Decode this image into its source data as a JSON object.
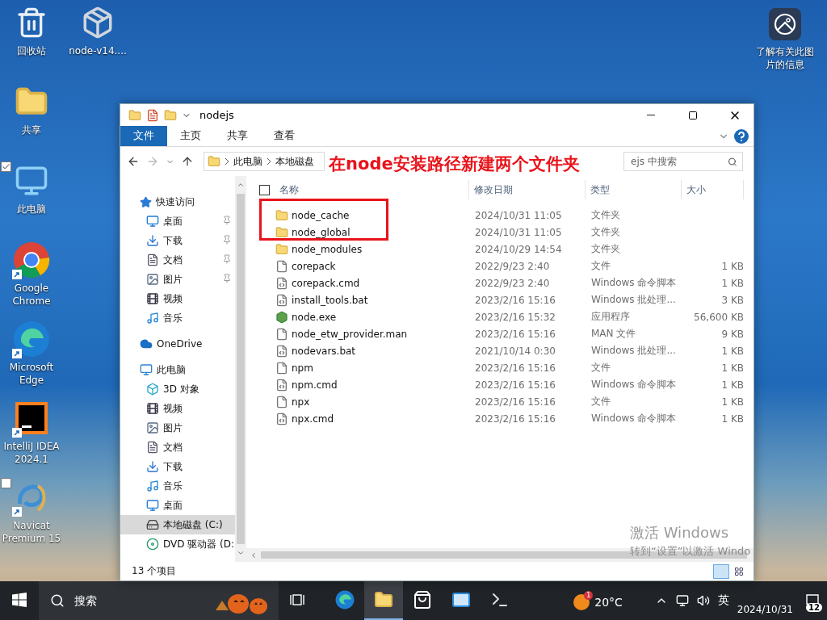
{
  "desktop": {
    "icons": [
      {
        "label": "回收站",
        "kind": "recycle"
      },
      {
        "label": "共享",
        "kind": "folder"
      },
      {
        "label": "此电脑",
        "kind": "computer",
        "checked": true
      },
      {
        "label": "Google Chrome",
        "kind": "chrome",
        "shortcut": true
      },
      {
        "label": "Microsoft Edge",
        "kind": "edge",
        "shortcut": true
      },
      {
        "label": "IntelliJ IDEA 2024.1",
        "kind": "idea",
        "shortcut": true
      },
      {
        "label": "Navicat Premium 15",
        "kind": "navicat",
        "shortcut": true,
        "checked": false
      },
      {
        "label": "node-v14....",
        "kind": "installer"
      }
    ],
    "info_icon": {
      "label": "了解有关此图片的信息"
    },
    "activation": {
      "title": "激活 Windows",
      "subtitle": "转到“设置”以激活 Windo"
    }
  },
  "window": {
    "title": "nodejs",
    "ribbon_tabs": [
      {
        "label": "文件",
        "kind": "file_menu"
      },
      {
        "label": "主页",
        "kind": "tab"
      },
      {
        "label": "共享",
        "kind": "tab"
      },
      {
        "label": "查看",
        "kind": "tab"
      }
    ],
    "breadcrumbs": [
      "此电脑",
      "本地磁盘"
    ],
    "search": {
      "placeholder": "ejs 中搜索"
    },
    "sidebar": {
      "items": [
        {
          "label": "快速访问",
          "kind": "star",
          "selected": false,
          "children": [
            {
              "label": "桌面",
              "kind": "desktop",
              "pinned": true,
              "selected": false
            },
            {
              "label": "下载",
              "kind": "download",
              "pinned": true,
              "selected": false
            },
            {
              "label": "文档",
              "kind": "document",
              "pinned": true,
              "selected": false
            },
            {
              "label": "图片",
              "kind": "picture",
              "pinned": true,
              "selected": false
            },
            {
              "label": "视频",
              "kind": "video",
              "pinned": false,
              "selected": false
            },
            {
              "label": "音乐",
              "kind": "music",
              "pinned": false,
              "selected": false
            }
          ]
        },
        {
          "label": "OneDrive",
          "kind": "cloud",
          "selected": false
        },
        {
          "label": "此电脑",
          "kind": "computer",
          "selected": false,
          "children": [
            {
              "label": "3D 对象",
              "kind": "cube",
              "selected": false
            },
            {
              "label": "视频",
              "kind": "video",
              "selected": false
            },
            {
              "label": "图片",
              "kind": "picture",
              "selected": false
            },
            {
              "label": "文档",
              "kind": "document",
              "selected": false
            },
            {
              "label": "下载",
              "kind": "download",
              "selected": false
            },
            {
              "label": "音乐",
              "kind": "music",
              "selected": false
            },
            {
              "label": "桌面",
              "kind": "desktop",
              "selected": false
            },
            {
              "label": "本地磁盘 (C:)",
              "kind": "drive",
              "selected": true
            },
            {
              "label": "DVD 驱动器 (D:",
              "kind": "dvd",
              "selected": false
            }
          ]
        }
      ]
    },
    "table": {
      "select_all": {
        "checked": false
      },
      "columns": [
        "名称",
        "修改日期",
        "类型",
        "大小"
      ],
      "rows": [
        {
          "kind": "folder",
          "name": "node_cache",
          "date": "2024/10/31 11:05",
          "type": "文件夹"
        },
        {
          "kind": "folder",
          "name": "node_global",
          "date": "2024/10/31 11:05",
          "type": "文件夹"
        },
        {
          "kind": "folder",
          "name": "node_modules",
          "date": "2024/10/29 14:54",
          "type": "文件夹"
        },
        {
          "kind": "file",
          "name": "corepack",
          "date": "2022/9/23 2:40",
          "type": "文件",
          "size": "1 KB"
        },
        {
          "kind": "script",
          "name": "corepack.cmd",
          "date": "2022/9/23 2:40",
          "type": "Windows 命令脚本",
          "size": "1 KB"
        },
        {
          "kind": "script",
          "name": "install_tools.bat",
          "date": "2023/2/16 15:16",
          "type": "Windows 批处理...",
          "size": "3 KB"
        },
        {
          "kind": "exe",
          "name": "node.exe",
          "date": "2023/2/16 15:32",
          "type": "应用程序",
          "size": "56,600 KB"
        },
        {
          "kind": "file",
          "name": "node_etw_provider.man",
          "date": "2023/2/16 15:16",
          "type": "MAN 文件",
          "size": "9 KB"
        },
        {
          "kind": "script",
          "name": "nodevars.bat",
          "date": "2021/10/14 0:30",
          "type": "Windows 批处理...",
          "size": "1 KB"
        },
        {
          "kind": "file",
          "name": "npm",
          "date": "2023/2/16 15:16",
          "type": "文件",
          "size": "1 KB"
        },
        {
          "kind": "script",
          "name": "npm.cmd",
          "date": "2023/2/16 15:16",
          "type": "Windows 命令脚本",
          "size": "1 KB"
        },
        {
          "kind": "file",
          "name": "npx",
          "date": "2023/2/16 15:16",
          "type": "文件",
          "size": "1 KB"
        },
        {
          "kind": "script",
          "name": "npx.cmd",
          "date": "2023/2/16 15:16",
          "type": "Windows 命令脚本",
          "size": "1 KB"
        }
      ]
    },
    "status_bar": {
      "count": "13 个项目",
      "views": [
        {
          "kind": "details",
          "selected": true
        },
        {
          "kind": "tiles",
          "selected": false
        }
      ]
    },
    "annotation": {
      "text": "在node安装路径新建两个文件夹"
    }
  },
  "taskbar": {
    "search": {
      "placeholder": "搜索"
    },
    "apps": [
      {
        "kind": "edge",
        "selected": false
      },
      {
        "kind": "explorer",
        "selected": true
      },
      {
        "kind": "store",
        "selected": false
      },
      {
        "kind": "mail",
        "selected": false
      },
      {
        "kind": "terminal",
        "selected": false
      }
    ],
    "weather": {
      "temperature": "20°C",
      "badge": "1"
    },
    "ime": "英",
    "date": "2024/10/31",
    "notifications": "12"
  }
}
